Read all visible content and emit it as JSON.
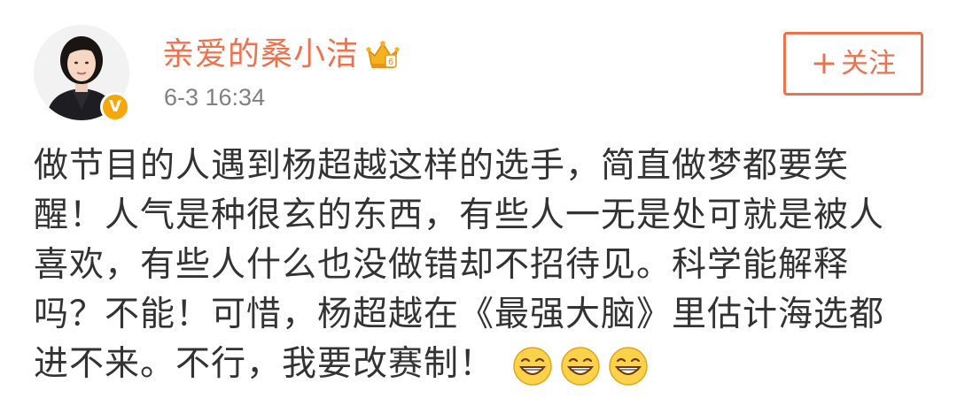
{
  "author": {
    "name": "亲爱的桑小洁",
    "avatar_icon": "avatar-photo",
    "verified_icon": "verified-badge-icon",
    "verified_symbol": "V",
    "vip_icon": "crown-vip-icon",
    "name_color": "#eb7350",
    "verified_color": "#f6a70b"
  },
  "post": {
    "timestamp": "6-3 16:34",
    "lines": [
      "做节目的人遇到杨超越这样的选手，简直做梦都要笑",
      "醒！人气是种很玄的东西，有些人一无是处可就是被人",
      "喜欢，有些人什么也没做错却不招待见。科学能解释",
      "吗？不能！可惜，杨超越在《最强大脑》里估计海选都",
      "进不来。不行，我要改赛制！"
    ],
    "trailing_emoji": [
      "grin-emoji-icon",
      "grin-emoji-icon",
      "grin-emoji-icon"
    ]
  },
  "follow_button": {
    "plus_symbol": "+",
    "label": "关注",
    "color": "#eb7350"
  }
}
